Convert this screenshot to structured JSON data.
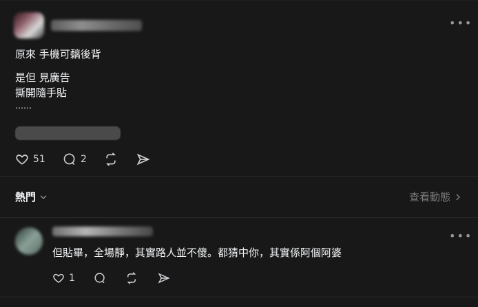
{
  "post": {
    "text_lines": [
      "原來 手機可黐後背",
      "是但 見廣告",
      "撕開隨手貼",
      "……"
    ],
    "likes": "51",
    "comments": "2"
  },
  "filter": {
    "label": "熱門",
    "view_activity": "查看動態"
  },
  "reply": {
    "text": "但貼畢，全場靜，其實路人並不傻。都猜中你，其實係阿個阿婆",
    "likes": "1"
  },
  "colors": {
    "background": "#181818",
    "text": "#f3f5f7",
    "muted": "#777777",
    "divider": "#2b2b2b"
  },
  "icons": [
    "heart-icon",
    "comment-icon",
    "repost-icon",
    "share-icon",
    "chevron-down-icon",
    "chevron-right-icon",
    "more-icon"
  ]
}
